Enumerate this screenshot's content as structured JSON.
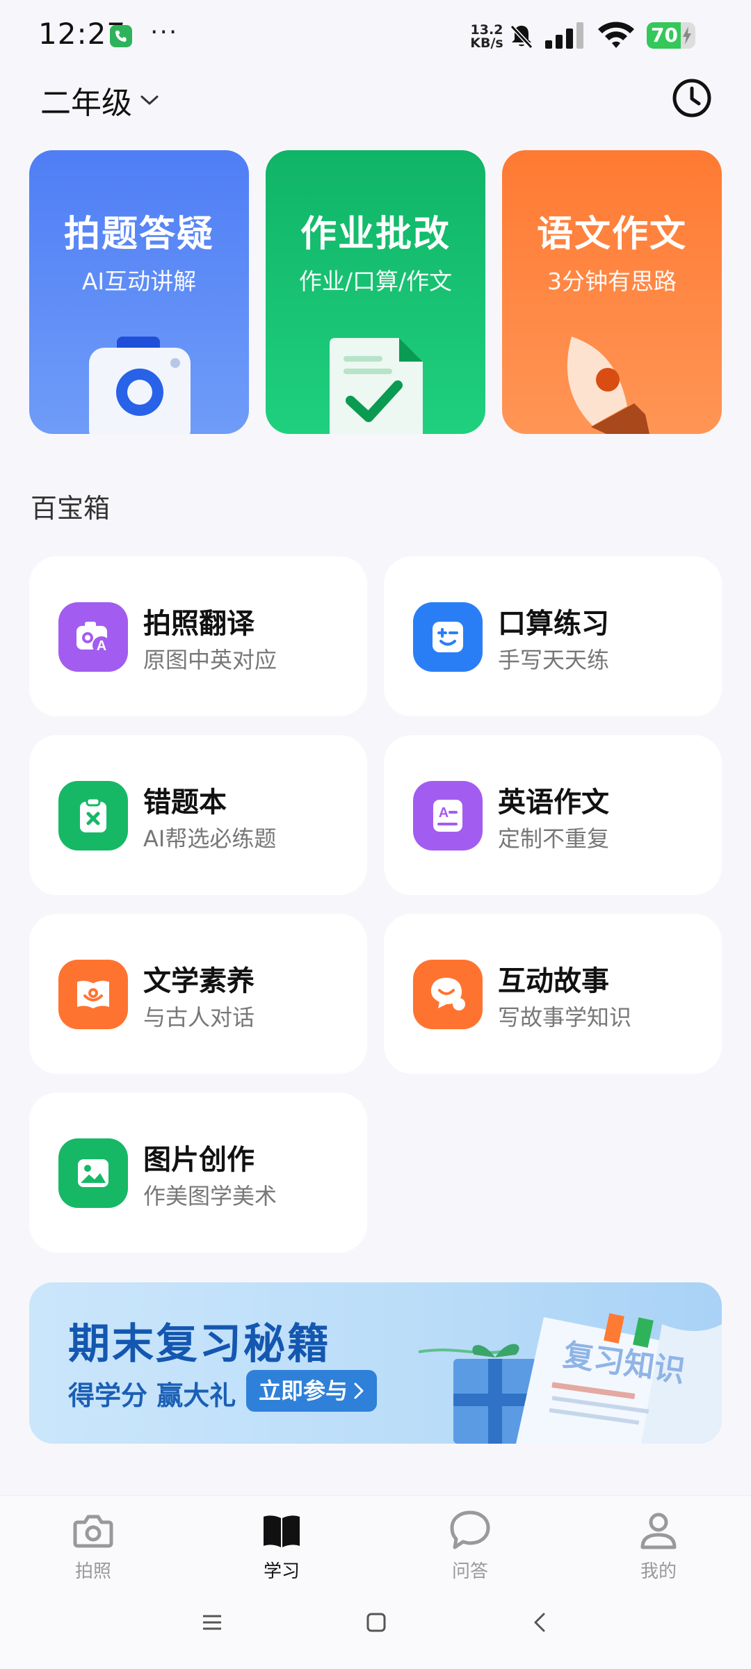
{
  "status_bar": {
    "time": "12:27",
    "more": "···",
    "net_speed_value": "13.2",
    "net_speed_unit": "KB/s",
    "battery_level": "70",
    "battery_percent": 70
  },
  "header": {
    "grade": "二年级",
    "history_icon": "clock-icon"
  },
  "feature_cards": [
    {
      "title": "拍题答疑",
      "subtitle": "AI互动讲解",
      "color": "#4f7ef5"
    },
    {
      "title": "作业批改",
      "subtitle": "作业/口算/作文",
      "color": "#10b466"
    },
    {
      "title": "语文作文",
      "subtitle": "3分钟有思路",
      "color": "#ff7a33"
    }
  ],
  "toolbox": {
    "title": "百宝箱",
    "items": [
      {
        "name": "拍照翻译",
        "desc": "原图中英对应",
        "icon": "photo-translate-icon",
        "color": "#a35cf0"
      },
      {
        "name": "口算练习",
        "desc": "手写天天练",
        "icon": "math-face-icon",
        "color": "#2a7ef5"
      },
      {
        "name": "错题本",
        "desc": "AI帮选必练题",
        "icon": "clipboard-x-icon",
        "color": "#16b866"
      },
      {
        "name": "英语作文",
        "desc": "定制不重复",
        "icon": "english-essay-icon",
        "color": "#a35cf0"
      },
      {
        "name": "文学素养",
        "desc": "与古人对话",
        "icon": "book-smile-icon",
        "color": "#ff7330"
      },
      {
        "name": "互动故事",
        "desc": "写故事学知识",
        "icon": "chat-bubbles-icon",
        "color": "#ff7330"
      },
      {
        "name": "图片创作",
        "desc": "作美图学美术",
        "icon": "image-icon",
        "color": "#16b866"
      }
    ]
  },
  "banner": {
    "title": "期末复习秘籍",
    "subtitle": "得学分 赢大礼",
    "button": "立即参与",
    "book_text": "复习知识"
  },
  "bottom_nav": {
    "items": [
      {
        "label": "拍照",
        "icon": "camera-icon"
      },
      {
        "label": "学习",
        "icon": "book-icon"
      },
      {
        "label": "问答",
        "icon": "chat-icon"
      },
      {
        "label": "我的",
        "icon": "profile-icon"
      }
    ],
    "active": "学习"
  }
}
